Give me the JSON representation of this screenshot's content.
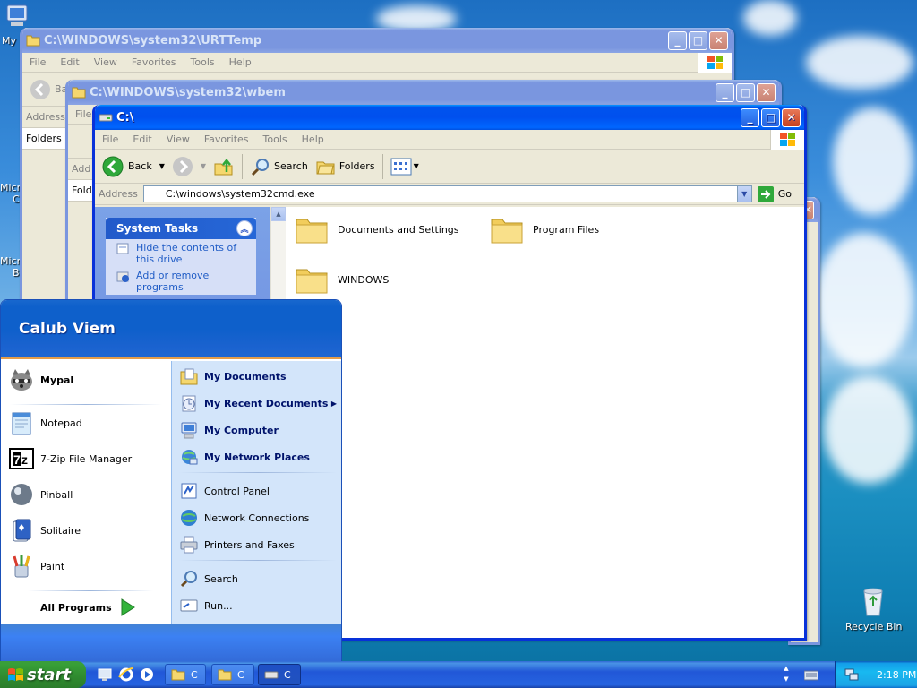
{
  "desktop": {
    "icons": [
      {
        "label": "My"
      },
      {
        "label": "Micro"
      },
      {
        "label": "C"
      },
      {
        "label": "Micro"
      },
      {
        "label": "B"
      },
      {
        "label": "Recycle Bin"
      }
    ]
  },
  "windows": {
    "urttemp": {
      "title": "C:\\WINDOWS\\system32\\URTTemp",
      "menu": [
        "File",
        "Edit",
        "View",
        "Favorites",
        "Tools",
        "Help"
      ],
      "back_label": "Ba",
      "address_label": "Address",
      "folders_label": "Folders"
    },
    "wbem": {
      "title": "C:\\WINDOWS\\system32\\wbem",
      "menu_first": "File",
      "address_label": "Add",
      "folders_label": "Fold"
    },
    "croot": {
      "title": "C:\\",
      "menu": [
        "File",
        "Edit",
        "View",
        "Favorites",
        "Tools",
        "Help"
      ],
      "toolbar": {
        "back": "Back",
        "search": "Search",
        "folders": "Folders"
      },
      "address_label": "Address",
      "address_value": "C:\\windows\\system32cmd.exe",
      "go_label": "Go",
      "tasks": {
        "header": "System Tasks",
        "items": [
          "Hide the contents of this drive",
          "Add or remove programs"
        ]
      },
      "folders": [
        "Documents and Settings",
        "Program Files",
        "WINDOWS"
      ]
    }
  },
  "start_menu": {
    "user": "Calub Viem",
    "pinned": [
      {
        "label": "Mypal",
        "icon": "raccoon-icon"
      }
    ],
    "recent": [
      {
        "label": "Notepad",
        "icon": "notepad-icon"
      },
      {
        "label": "7-Zip File Manager",
        "icon": "7zip-icon"
      },
      {
        "label": "Pinball",
        "icon": "pinball-icon"
      },
      {
        "label": "Solitaire",
        "icon": "solitaire-icon"
      },
      {
        "label": "Paint",
        "icon": "paint-icon"
      }
    ],
    "all_programs": "All Programs",
    "right": {
      "group1": [
        "My Documents",
        "My Recent Documents",
        "My Computer",
        "My Network Places"
      ],
      "group2": [
        "Control Panel",
        "Network Connections",
        "Printers and Faxes"
      ],
      "group3": [
        "Search",
        "Run..."
      ]
    }
  },
  "taskbar": {
    "start": "start",
    "buttons": [
      "C",
      "C",
      "C"
    ],
    "clock": "2:18 PM"
  },
  "colors": {
    "titlebar_active": "#0053ee",
    "titlebar_inactive": "#7a96df",
    "start_green": "#2f8a2f",
    "link_blue": "#215dc6"
  }
}
